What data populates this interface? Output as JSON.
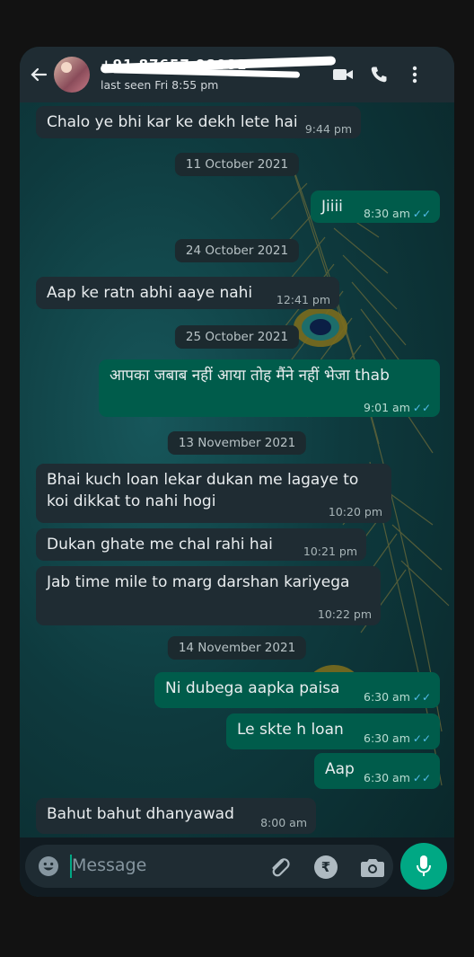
{
  "header": {
    "contact_name": "+91 87657 98081",
    "last_seen": "last seen Fri 8:55 pm"
  },
  "icons": {
    "back": "arrow-left-icon",
    "video": "video-camera-icon",
    "call": "phone-icon",
    "menu": "kebab-menu-icon",
    "emoji": "emoji-icon",
    "attach": "paperclip-icon",
    "payment": "rupee-icon",
    "camera": "camera-icon",
    "mic": "microphone-icon"
  },
  "colors": {
    "incoming_bubble": "#1f2c33",
    "outgoing_bubble": "#005c4b",
    "read_ticks": "#53bdeb",
    "mic_button": "#00a884"
  },
  "messages": [
    {
      "text": "Chalo ye bhi kar ke dekh lete hai",
      "time": "9:44 pm"
    },
    {
      "date": "11 October 2021"
    },
    {
      "text": "Jiiii",
      "time": "8:30 am",
      "ticks": "✓✓"
    },
    {
      "date": "24 October 2021"
    },
    {
      "text": "Aap ke ratn abhi aaye nahi",
      "time": "12:41 pm"
    },
    {
      "date": "25 October 2021"
    },
    {
      "text": "आपका जबाब नहीं आया तोह मैंने नहीं भेजा thab",
      "time": "9:01 am",
      "ticks": "✓✓"
    },
    {
      "date": "13 November 2021"
    },
    {
      "line1": "Bhai kuch loan lekar dukan me lagaye to",
      "line2": "koi dikkat to nahi hogi",
      "time": "10:20 pm"
    },
    {
      "text": "Dukan ghate me chal rahi hai",
      "time": "10:21 pm"
    },
    {
      "text": "Jab time mile to marg darshan kariyega",
      "time": "10:22 pm"
    },
    {
      "date": "14 November 2021"
    },
    {
      "text": "Ni dubega aapka paisa",
      "time": "6:30 am",
      "ticks": "✓✓"
    },
    {
      "text": "Le skte h loan",
      "time": "6:30 am",
      "ticks": "✓✓"
    },
    {
      "text": "Aap",
      "time": "6:30 am",
      "ticks": "✓✓"
    },
    {
      "text": "Bahut bahut dhanyawad",
      "time": "8:00 am"
    }
  ],
  "composer": {
    "placeholder": "Message",
    "payment_symbol": "₹"
  }
}
